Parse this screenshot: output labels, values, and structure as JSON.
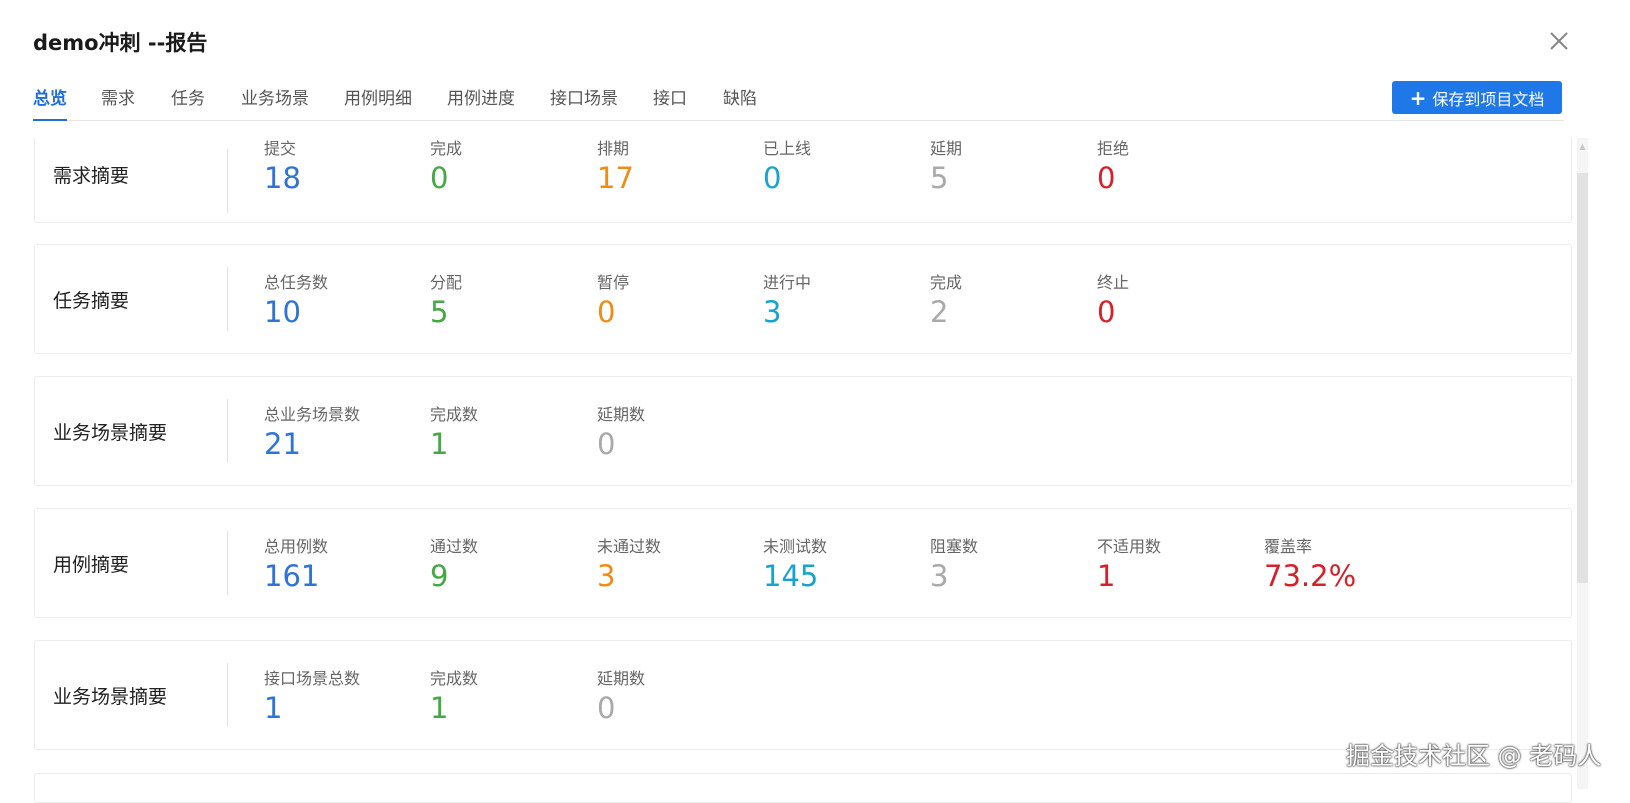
{
  "dialog": {
    "title": "demo冲刺 --报告"
  },
  "tabs": [
    {
      "label": "总览",
      "active": true
    },
    {
      "label": "需求"
    },
    {
      "label": "任务"
    },
    {
      "label": "业务场景"
    },
    {
      "label": "用例明细"
    },
    {
      "label": "用例进度"
    },
    {
      "label": "接口场景"
    },
    {
      "label": "接口"
    },
    {
      "label": "缺陷"
    }
  ],
  "toolbar": {
    "save_label": "保存到项目文档"
  },
  "colors": {
    "blue": "#2f73d6",
    "green": "#44a844",
    "orange": "#ef8c16",
    "cyan": "#17a3d0",
    "grey": "#a9a9a9",
    "red": "#d7202a",
    "accent": "#1f78e8"
  },
  "cards": [
    {
      "title": "需求摘要",
      "stats": [
        {
          "label": "提交",
          "value": "18",
          "color": "blue"
        },
        {
          "label": "完成",
          "value": "0",
          "color": "green"
        },
        {
          "label": "排期",
          "value": "17",
          "color": "orange"
        },
        {
          "label": "已上线",
          "value": "0",
          "color": "cyan"
        },
        {
          "label": "延期",
          "value": "5",
          "color": "grey"
        },
        {
          "label": "拒绝",
          "value": "0",
          "color": "red"
        }
      ]
    },
    {
      "title": "任务摘要",
      "stats": [
        {
          "label": "总任务数",
          "value": "10",
          "color": "blue"
        },
        {
          "label": "分配",
          "value": "5",
          "color": "green"
        },
        {
          "label": "暂停",
          "value": "0",
          "color": "orange"
        },
        {
          "label": "进行中",
          "value": "3",
          "color": "cyan"
        },
        {
          "label": "完成",
          "value": "2",
          "color": "grey"
        },
        {
          "label": "终止",
          "value": "0",
          "color": "red"
        }
      ]
    },
    {
      "title": "业务场景摘要",
      "stats": [
        {
          "label": "总业务场景数",
          "value": "21",
          "color": "blue"
        },
        {
          "label": "完成数",
          "value": "1",
          "color": "green"
        },
        {
          "label": "延期数",
          "value": "0",
          "color": "grey"
        }
      ]
    },
    {
      "title": "用例摘要",
      "stats": [
        {
          "label": "总用例数",
          "value": "161",
          "color": "blue"
        },
        {
          "label": "通过数",
          "value": "9",
          "color": "green"
        },
        {
          "label": "未通过数",
          "value": "3",
          "color": "orange"
        },
        {
          "label": "未测试数",
          "value": "145",
          "color": "cyan"
        },
        {
          "label": "阻塞数",
          "value": "3",
          "color": "grey"
        },
        {
          "label": "不适用数",
          "value": "1",
          "color": "red"
        },
        {
          "label": "覆盖率",
          "value": "73.2%",
          "color": "red"
        }
      ]
    },
    {
      "title": "业务场景摘要",
      "stats": [
        {
          "label": "接口场景总数",
          "value": "1",
          "color": "blue"
        },
        {
          "label": "完成数",
          "value": "1",
          "color": "green"
        },
        {
          "label": "延期数",
          "value": "0",
          "color": "grey"
        }
      ]
    }
  ],
  "watermark": "掘金技术社区 @ 老码人"
}
